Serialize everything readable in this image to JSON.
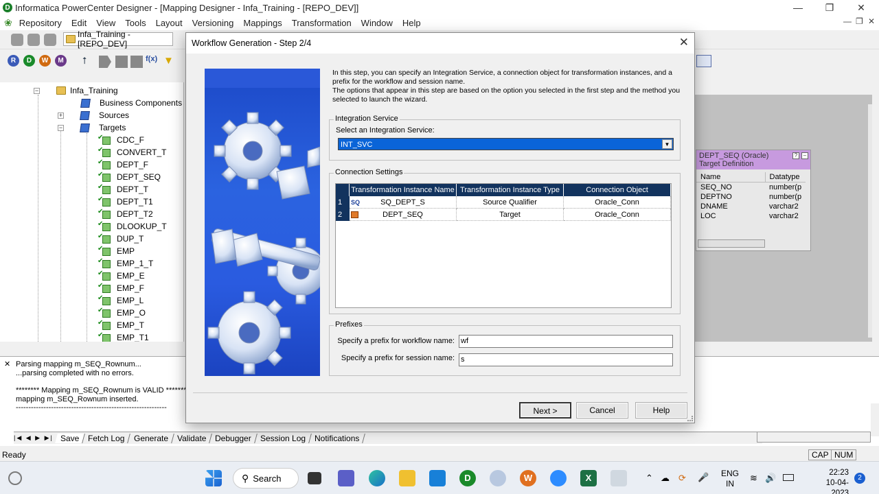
{
  "app": {
    "title": "Informatica PowerCenter Designer - [Mapping Designer - Infa_Training - [REPO_DEV]]",
    "icon_letter": "D"
  },
  "menu": [
    "Repository",
    "Edit",
    "View",
    "Tools",
    "Layout",
    "Versioning",
    "Mappings",
    "Transformation",
    "Window",
    "Help"
  ],
  "toolbar": {
    "folder_selector": "Infa_Training - [REPO_DEV]",
    "client_buttons": [
      "R",
      "D",
      "W",
      "M"
    ],
    "fx_label": "f(x)"
  },
  "navigator": {
    "root": "Infa_Training",
    "nodes": [
      "Business Components",
      "Sources",
      "Targets"
    ],
    "targets": [
      "CDC_F",
      "CONVERT_T",
      "DEPT_F",
      "DEPT_SEQ",
      "DEPT_T",
      "DEPT_T1",
      "DEPT_T2",
      "DLOOKUP_T",
      "DUP_T",
      "EMP",
      "EMP_1_T",
      "EMP_E",
      "EMP_F",
      "EMP_L",
      "EMP_O",
      "EMP_T",
      "EMP_T1"
    ]
  },
  "target_definition": {
    "title": "DEPT_SEQ (Oracle)",
    "subtitle": "Target Definition",
    "columns": [
      "Name",
      "Datatype"
    ],
    "rows": [
      [
        "SEQ_NO",
        "number(p"
      ],
      [
        "DEPTNO",
        "number(p"
      ],
      [
        "DNAME",
        "varchar2"
      ],
      [
        "LOC",
        "varchar2"
      ]
    ]
  },
  "output": {
    "lines": [
      "Parsing mapping m_SEQ_Rownum...",
      "...parsing completed with no errors.",
      "",
      "******** Mapping m_SEQ_Rownum is VALID ********",
      "mapping  m_SEQ_Rownum inserted.",
      "------------------------------------------------------------"
    ],
    "tabs": [
      "Save",
      "Fetch Log",
      "Generate",
      "Validate",
      "Debugger",
      "Session Log",
      "Notifications"
    ]
  },
  "status": {
    "text": "Ready",
    "indicators": [
      "CAP",
      "NUM"
    ]
  },
  "dialog": {
    "title": "Workflow Generation - Step 2/4",
    "intro_1": "In this step, you can specify an Integration Service, a connection object for transformation instances, and a prefix for the workflow and session name.",
    "intro_2": "The options that appear in this step are based on the option you selected in the first step and the method you selected to launch the wizard.",
    "integration_service": {
      "group_label": "Integration Service",
      "field_label": "Select an Integration Service:",
      "value": "INT_SVC"
    },
    "connection_settings": {
      "group_label": "Connection Settings",
      "headers": [
        "Transformation Instance Name",
        "Transformation Instance Type",
        "Connection Object"
      ],
      "rows": [
        {
          "num": "1",
          "icon": "SQ",
          "name": "SQ_DEPT_S",
          "type": "Source Qualifier",
          "conn": "Oracle_Conn"
        },
        {
          "num": "2",
          "icon": "target",
          "name": "DEPT_SEQ",
          "type": "Target",
          "conn": "Oracle_Conn"
        }
      ]
    },
    "prefixes": {
      "group_label": "Prefixes",
      "workflow_label": "Specify a prefix for workflow name:",
      "workflow_value": "wf",
      "session_label": "Specify a prefix for session name:",
      "session_value": "s"
    },
    "buttons": {
      "next": "Next >",
      "cancel": "Cancel",
      "help": "Help"
    }
  },
  "taskbar": {
    "search": "Search",
    "lang_1": "ENG",
    "lang_2": "IN",
    "time": "22:23",
    "date": "10-04-2023",
    "notifications": "2"
  }
}
